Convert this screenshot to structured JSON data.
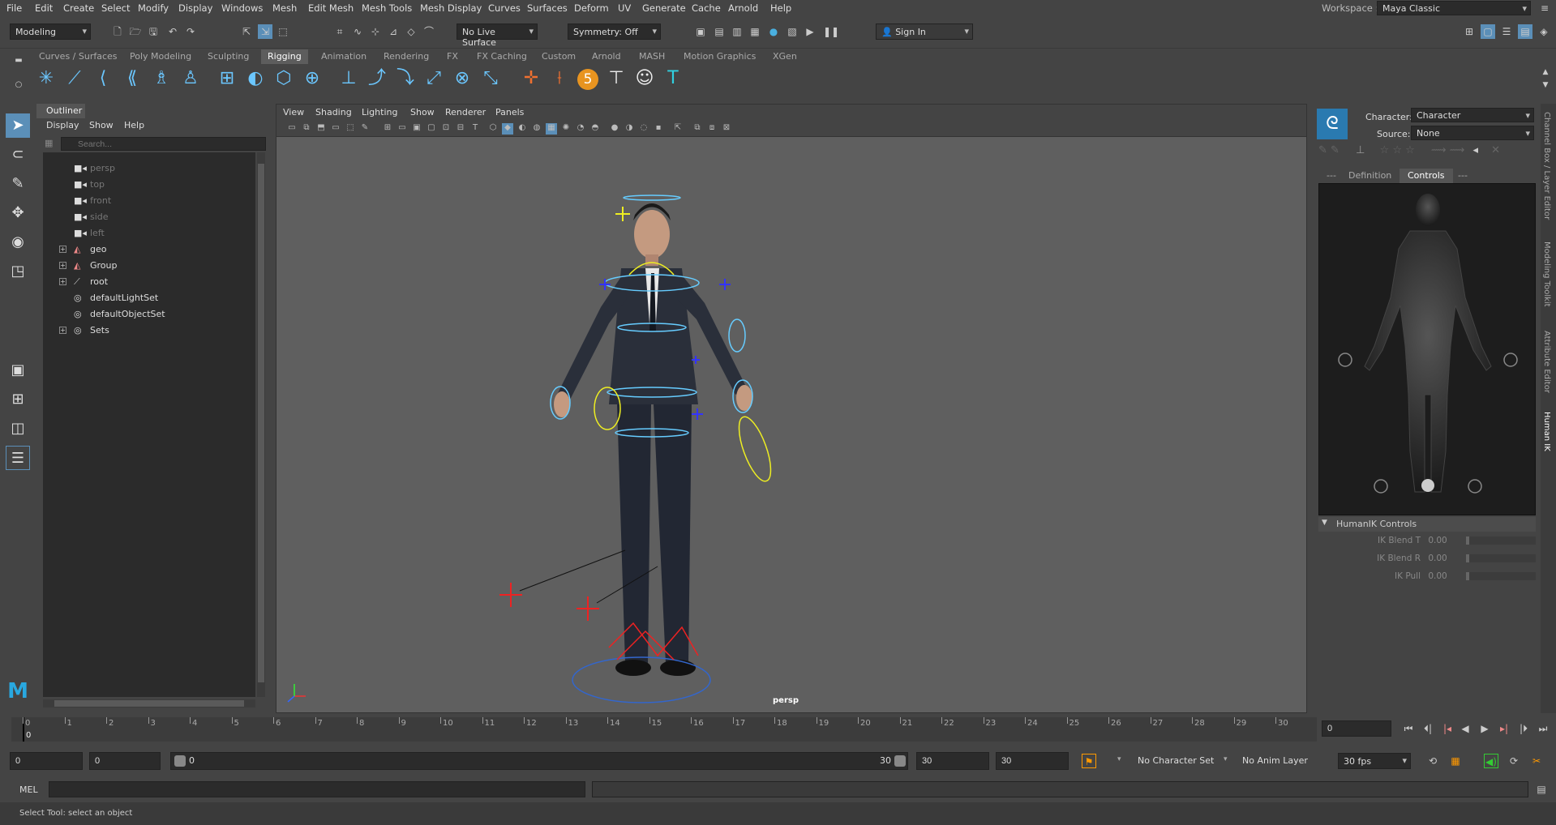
{
  "menubar": {
    "items": [
      "File",
      "Edit",
      "Create",
      "Select",
      "Modify",
      "Display",
      "Windows",
      "Mesh",
      "Edit Mesh",
      "Mesh Tools",
      "Mesh Display",
      "Curves",
      "Surfaces",
      "Deform",
      "UV",
      "Generate",
      "Cache",
      "Arnold",
      "Help"
    ],
    "workspace_label": "Workspace :",
    "workspace_value": "Maya Classic"
  },
  "statusline": {
    "mode": "Modeling",
    "live_surface": "No Live Surface",
    "symmetry": "Symmetry: Off",
    "sign_in": "Sign In"
  },
  "shelf": {
    "tabs": [
      "Curves / Surfaces",
      "Poly Modeling",
      "Sculpting",
      "Rigging",
      "Animation",
      "Rendering",
      "FX",
      "FX Caching",
      "Custom",
      "Arnold",
      "MASH",
      "Motion Graphics",
      "XGen"
    ],
    "active_tab": "Rigging",
    "badge_number": "5"
  },
  "outliner": {
    "title": "Outliner",
    "menu": [
      "Display",
      "Show",
      "Help"
    ],
    "search_placeholder": "Search...",
    "items": [
      {
        "label": "persp",
        "icon": "camera-icon",
        "expandable": false,
        "dim": true
      },
      {
        "label": "top",
        "icon": "camera-icon",
        "expandable": false,
        "dim": true
      },
      {
        "label": "front",
        "icon": "camera-icon",
        "expandable": false,
        "dim": true
      },
      {
        "label": "side",
        "icon": "camera-icon",
        "expandable": false,
        "dim": true
      },
      {
        "label": "left",
        "icon": "camera-icon",
        "expandable": false,
        "dim": true
      },
      {
        "label": "geo",
        "icon": "mesh-icon",
        "expandable": true,
        "dim": false
      },
      {
        "label": "Group",
        "icon": "mesh-icon",
        "expandable": true,
        "dim": false
      },
      {
        "label": "root",
        "icon": "joint-icon",
        "expandable": true,
        "dim": false
      },
      {
        "label": "defaultLightSet",
        "icon": "set-icon",
        "expandable": false,
        "dim": false
      },
      {
        "label": "defaultObjectSet",
        "icon": "set-icon",
        "expandable": false,
        "dim": false
      },
      {
        "label": "Sets",
        "icon": "set-icon",
        "expandable": true,
        "dim": false
      }
    ]
  },
  "viewport": {
    "menu": [
      "View",
      "Shading",
      "Lighting",
      "Show",
      "Renderer",
      "Panels"
    ],
    "camera_label": "persp"
  },
  "hik": {
    "character_label": "Character:",
    "character_value": "Character",
    "source_label": "Source:",
    "source_value": "None",
    "tabs": [
      "---",
      "Definition",
      "Controls",
      "---"
    ],
    "active_tab": "Controls",
    "controls_section": "HumanIK Controls",
    "controls": [
      {
        "label": "IK Blend T",
        "value": "0.00"
      },
      {
        "label": "IK Blend R",
        "value": "0.00"
      },
      {
        "label": "IK Pull",
        "value": "0.00"
      }
    ]
  },
  "side_tabs": [
    "Channel Box / Layer Editor",
    "Modeling Toolkit",
    "Attribute Editor",
    "Human IK"
  ],
  "timeline": {
    "ticks": [
      "0",
      "1",
      "2",
      "3",
      "4",
      "5",
      "6",
      "7",
      "8",
      "9",
      "10",
      "11",
      "12",
      "13",
      "14",
      "15",
      "16",
      "17",
      "18",
      "19",
      "20",
      "21",
      "22",
      "23",
      "24",
      "25",
      "26",
      "27",
      "28",
      "29",
      "30"
    ],
    "current_frame": "0",
    "current_frame_field": "0"
  },
  "range": {
    "start": "0",
    "anim_start": "0",
    "slider_start": "0",
    "slider_end": "30",
    "anim_end": "30",
    "end": "30",
    "character_set": "No Character Set",
    "anim_layer": "No Anim Layer",
    "fps": "30 fps"
  },
  "mel": {
    "label": "MEL"
  },
  "help_line": "Select Tool: select an object"
}
